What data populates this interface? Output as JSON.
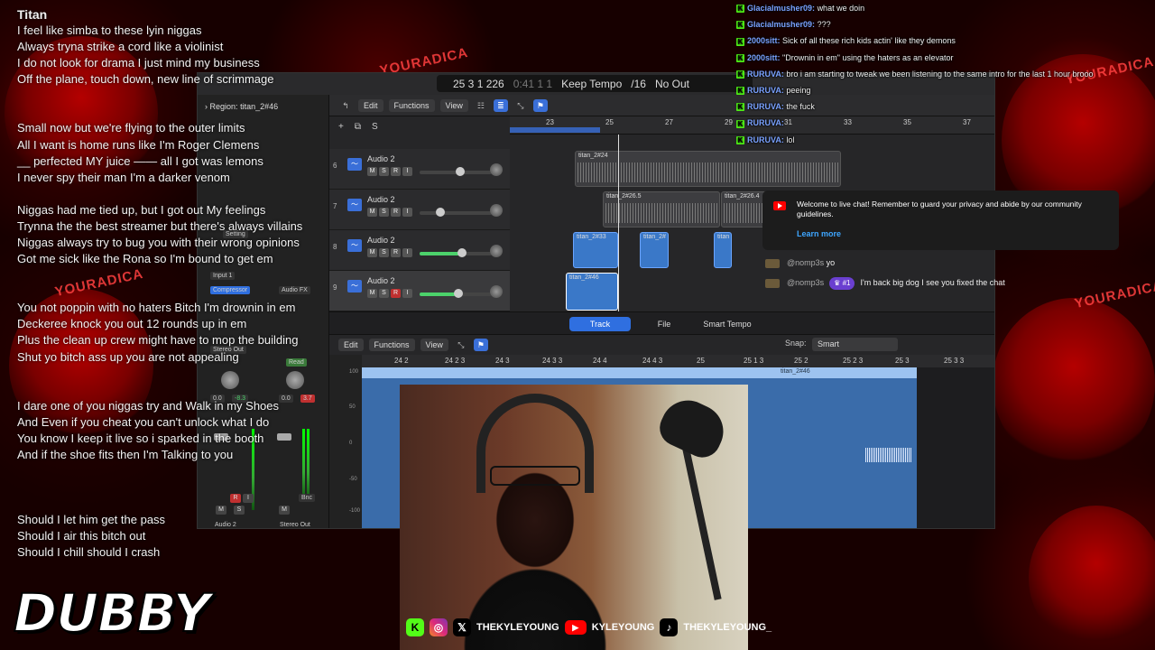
{
  "lyrics": {
    "title": "Titan",
    "stanzas": [
      [
        "I feel like simba to these lyin niggas",
        "Always tryna strike a cord like a violinist",
        "I do not look for drama I just mind my business",
        "Off the plane, touch down, new line of scrimmage"
      ],
      [
        "Small now but we're flying to the outer limits",
        "All I want is home runs like I'm Roger Clemens",
        "__ perfected MY juice —— all I got was lemons",
        "I never spy  their man I'm a darker venom"
      ],
      [
        "Niggas had me tied up, but I got out My feelings",
        "Trynna the the best streamer  but there's always villains",
        "Niggas always try to bug you with their wrong opinions",
        "Got me sick like the Rona so I'm bound to get em"
      ],
      [
        "You not poppin with no haters Bitch I'm drownin in em",
        "Deckeree knock you out 12 rounds up in em",
        "Plus the clean up crew might have to mop the building",
        "Shut yo bitch ass up you are not appealing"
      ],
      [
        "I dare one of you niggas try and Walk in my Shoes",
        "And Even if you cheat you can't unlock what I do",
        "You know I keep it live so i sparked in the booth",
        "And if the shoe fits  then I'm Talking to you"
      ],
      [
        "Should I let him get the pass",
        "Should I air this bitch out",
        "Should I chill should I crash"
      ]
    ]
  },
  "brand": {
    "logo": "DUBBY",
    "wordmark": "YOURADICA"
  },
  "daw": {
    "lcd": {
      "position": "25 3 1 226",
      "position2": "0:41 1 1",
      "tempo_mode": "Keep Tempo",
      "division": "/16",
      "output": "No Out"
    },
    "inspector": {
      "region_label": "Region:",
      "region_name": "titan_2#46",
      "input": "Input 1",
      "plugin": "Compressor",
      "audio_fx": "Audio FX",
      "setting": "Setting",
      "stereo_out": "Stereo Out",
      "read": "Read",
      "vol_left": "0.0",
      "vol_left2": "-8.3",
      "vol_right": "0.0",
      "vol_right2": "3.7",
      "ch_name_left": "Audio 2",
      "ch_name_right": "Stereo Out",
      "bnc": "Bnc",
      "m": "M",
      "s": "S",
      "r": "R",
      "i": "I"
    },
    "toolbar": {
      "edit": "Edit",
      "functions": "Functions",
      "view": "View"
    },
    "ruler": [
      "23",
      "25",
      "27",
      "29",
      "31",
      "33",
      "35",
      "37"
    ],
    "tracks": [
      {
        "num": "6",
        "name": "Audio 2",
        "clip": "titan_2#24"
      },
      {
        "num": "7",
        "name": "Audio 2",
        "clip": "titan_2#26.5",
        "clip2": "titan_2#26.4"
      },
      {
        "num": "8",
        "name": "Audio 2",
        "clip": "titan_2#33",
        "clip2": "titan_2#",
        "clip3": "titan"
      },
      {
        "num": "9",
        "name": "Audio 2",
        "clip": "titan_2#46"
      }
    ],
    "editor": {
      "tabs": [
        "Track",
        "File",
        "Smart Tempo"
      ],
      "edit": "Edit",
      "functions": "Functions",
      "view": "View",
      "snap_label": "Snap:",
      "snap_value": "Smart",
      "ruler": [
        "24 2",
        "24 2 3",
        "24 3",
        "24 3 3",
        "24 4",
        "24 4 3",
        "25",
        "25 1 3",
        "25 2",
        "25 2 3",
        "25 3",
        "25 3 3"
      ],
      "region": "titan_2#46",
      "amp": [
        "100",
        "50",
        "0",
        "-50",
        "-100"
      ]
    }
  },
  "chat": [
    {
      "user": "Glacialmusher09:",
      "text": "what we doin"
    },
    {
      "user": "Glacialmusher09:",
      "text": "???"
    },
    {
      "user": "2000sitt:",
      "text": "Sick of all these rich kids actin' like they demons"
    },
    {
      "user": "2000sitt:",
      "text": "\"Drownin in em\" using the haters as an elevator"
    },
    {
      "user": "RURUVA:",
      "text": "bro i am starting to tweak  we been listening to the same intro for the last 1 hour brooo"
    },
    {
      "user": "RURUVA:",
      "text": "peeing"
    },
    {
      "user": "RURUVA:",
      "text": "the fuck"
    },
    {
      "user": "RURUVA:",
      "text": ""
    },
    {
      "user": "RURUVA:",
      "text": "lol"
    }
  ],
  "youtube": {
    "welcome": "Welcome to live chat! Remember to guard your privacy and abide by our community guidelines.",
    "learn_more": "Learn more",
    "messages": [
      {
        "handle": "@nomp3s",
        "rank": "",
        "text": "yo"
      },
      {
        "handle": "@nomp3s",
        "rank": "#1",
        "text": "I'm back big dog I see you fixed the chat"
      }
    ]
  },
  "socials": {
    "x": "THEKYLEYOUNG",
    "youtube": "KYLEYOUNG",
    "tiktok": "THEKYLEYOUNG_"
  },
  "colors": {
    "kick": "#53fc18",
    "accent": "#3a6fd8",
    "chat_user": "#7aa2ff",
    "bg": "#170000"
  }
}
